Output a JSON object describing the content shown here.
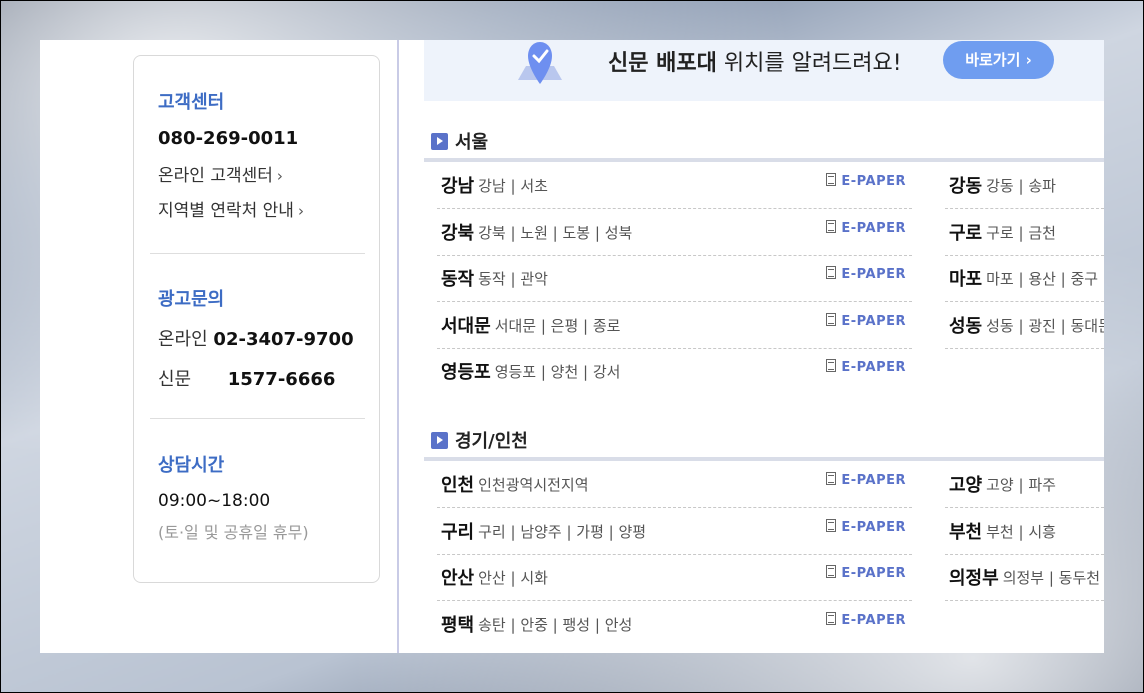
{
  "customer_center": {
    "title": "고객센터",
    "phone": "080-269-0011",
    "links": [
      "온라인 고객센터",
      "지역별 연락처 안내"
    ]
  },
  "ad_inquiry": {
    "title": "광고문의",
    "online_label": "온라인",
    "online_phone": "02-3407-9700",
    "paper_label": "신문",
    "paper_phone": "1577-6666"
  },
  "hours": {
    "title": "상담시간",
    "time": "09:00~18:00",
    "note": "(토·일 및 공휴일 휴무)"
  },
  "banner": {
    "text_bold": "신문 배포대",
    "text_rest": " 위치를 알려드려요!",
    "button": "바로가기 ›"
  },
  "epaper_label": "E-PAPER",
  "regions": [
    {
      "title": "서울",
      "left": [
        {
          "name": "강남",
          "sub": "강남 | 서초"
        },
        {
          "name": "강북",
          "sub": "강북 | 노원 | 도봉 | 성북"
        },
        {
          "name": "동작",
          "sub": "동작 | 관악"
        },
        {
          "name": "서대문",
          "sub": "서대문 | 은평 | 종로"
        },
        {
          "name": "영등포",
          "sub": "영등포 | 양천 | 강서"
        }
      ],
      "right": [
        {
          "name": "강동",
          "sub": "강동 | 송파"
        },
        {
          "name": "구로",
          "sub": "구로 | 금천"
        },
        {
          "name": "마포",
          "sub": "마포 | 용산 | 중구"
        },
        {
          "name": "성동",
          "sub": "성동 | 광진 | 동대문"
        }
      ]
    },
    {
      "title": "경기/인천",
      "left": [
        {
          "name": "인천",
          "sub": "인천광역시전지역"
        },
        {
          "name": "구리",
          "sub": "구리 | 남양주 | 가평 | 양평"
        },
        {
          "name": "안산",
          "sub": "안산 | 시화"
        },
        {
          "name": "평택",
          "sub": "송탄 | 안중 | 팽성 | 안성"
        }
      ],
      "right": [
        {
          "name": "고양",
          "sub": "고양 | 파주"
        },
        {
          "name": "부천",
          "sub": "부천 | 시흥"
        },
        {
          "name": "의정부",
          "sub": "의정부 | 동두천"
        }
      ]
    }
  ]
}
